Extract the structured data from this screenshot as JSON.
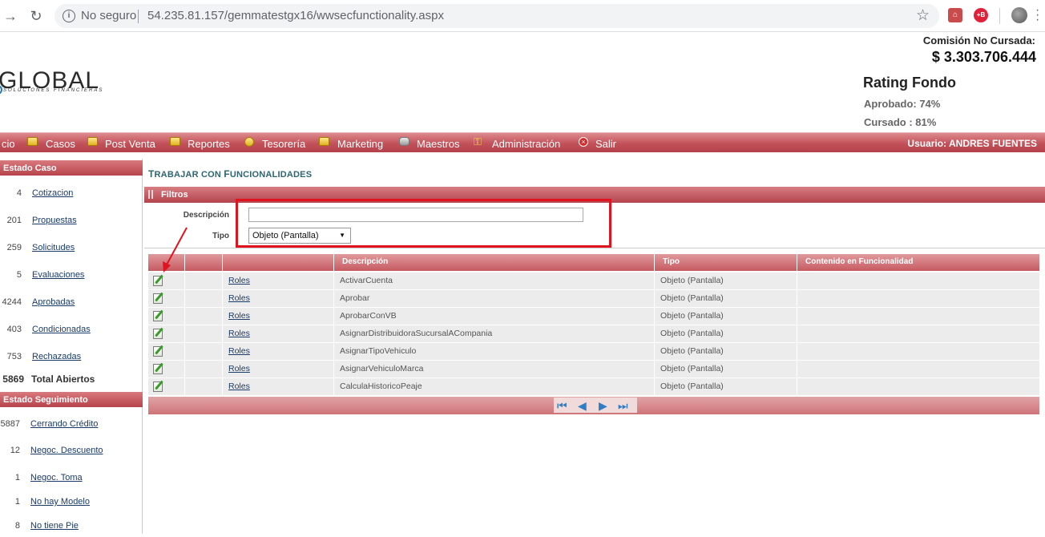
{
  "browser": {
    "back_icon": "arrow-back-icon",
    "reload_icon": "reload-icon",
    "security_label": "No seguro",
    "url": "54.235.81.157/gemmatestgx16/wwsecfunctionality.aspx"
  },
  "header": {
    "logo_text": "GLOBAL",
    "logo_sub": "SOLUCIONES FINANCIERAS",
    "commission_label": "Comisión No Cursada:",
    "commission_value": "$ 3.303.706.444",
    "rating_title": "Rating Fondo",
    "approved": "Aprobado: 74%",
    "processed": "Cursado : 81%"
  },
  "menu": {
    "items": [
      {
        "label": "cio"
      },
      {
        "label": "Casos"
      },
      {
        "label": "Post Venta"
      },
      {
        "label": "Reportes"
      },
      {
        "label": "Tesorería"
      },
      {
        "label": "Marketing"
      },
      {
        "label": "Maestros"
      },
      {
        "label": "Administración"
      },
      {
        "label": "Salir"
      }
    ],
    "user_label": "Usuario:  ANDRES FUENTES"
  },
  "sidebar": {
    "estado_caso_title": "Estado Caso",
    "estado_caso": [
      {
        "count": "4",
        "label": "Cotizacion"
      },
      {
        "count": "201",
        "label": "Propuestas"
      },
      {
        "count": "259",
        "label": "Solicitudes"
      },
      {
        "count": "5",
        "label": "Evaluaciones"
      },
      {
        "count": "4244",
        "label": "Aprobadas"
      },
      {
        "count": "403",
        "label": "Condicionadas"
      },
      {
        "count": "753",
        "label": "Rechazadas"
      }
    ],
    "total_count": "5869",
    "total_label": "Total Abiertos",
    "estado_seguimiento_title": "Estado Seguimiento",
    "estado_seguimiento": [
      {
        "count": "5887",
        "label": "Cerrando Crédito"
      },
      {
        "count": "12",
        "label": "Negoc. Descuento"
      },
      {
        "count": "1",
        "label": "Negoc. Toma"
      },
      {
        "count": "1",
        "label": "No hay Modelo"
      },
      {
        "count": "8",
        "label": "No tiene Pie"
      }
    ]
  },
  "main": {
    "title_first": "T",
    "title_rest": "RABAJAR CON ",
    "title_second": "F",
    "title_rest2": "UNCIONALIDADES",
    "filters_title": "Filtros",
    "filter_desc_label": "Descripción",
    "filter_desc_value": "",
    "filter_tipo_label": "Tipo",
    "filter_tipo_value": "Objeto (Pantalla)",
    "columns": [
      "",
      "",
      "",
      "Descripción",
      "Tipo",
      "Contenido en Funcionalidad"
    ],
    "rows": [
      {
        "link": "Roles",
        "description": "ActivarCuenta",
        "type": "Objeto (Pantalla)",
        "content": ""
      },
      {
        "link": "Roles",
        "description": "Aprobar",
        "type": "Objeto (Pantalla)",
        "content": ""
      },
      {
        "link": "Roles",
        "description": "AprobarConVB",
        "type": "Objeto (Pantalla)",
        "content": ""
      },
      {
        "link": "Roles",
        "description": "AsignarDistribuidoraSucursalACompania",
        "type": "Objeto (Pantalla)",
        "content": ""
      },
      {
        "link": "Roles",
        "description": "AsignarTipoVehiculo",
        "type": "Objeto (Pantalla)",
        "content": ""
      },
      {
        "link": "Roles",
        "description": "AsignarVehiculoMarca",
        "type": "Objeto (Pantalla)",
        "content": ""
      },
      {
        "link": "Roles",
        "description": "CalculaHistoricoPeaje",
        "type": "Objeto (Pantalla)",
        "content": ""
      }
    ],
    "pager_icons": [
      "first-page-icon",
      "previous-page-icon",
      "next-page-icon",
      "last-page-icon"
    ]
  },
  "colors": {
    "menu_red": "#c2525a",
    "title_teal": "#2d6570",
    "highlight_red": "#e0141e",
    "link_blue": "#1a3a6a"
  }
}
